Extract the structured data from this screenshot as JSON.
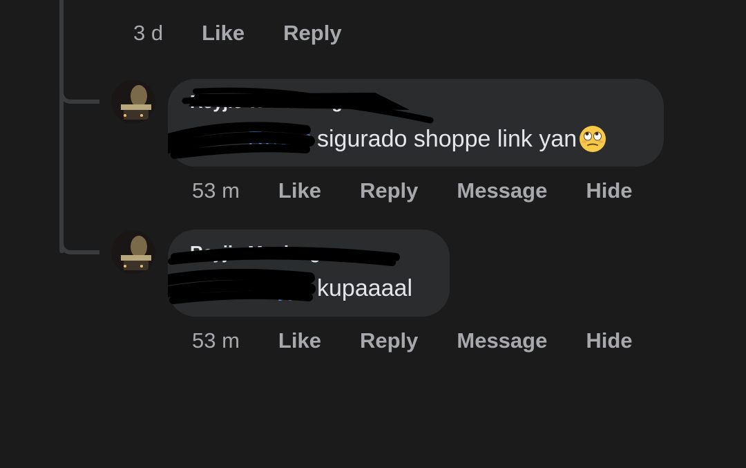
{
  "top_comment": {
    "time": "3 d",
    "like_label": "Like",
    "reply_label": "Reply"
  },
  "replies": [
    {
      "author": "Reyjie W Manlang",
      "mention": "Reyjie",
      "text": "sigurado shoppe link yan",
      "emoji": "face-with-rolling-eyes-emoji",
      "time": "53 m",
      "like_label": "Like",
      "reply_label": "Reply",
      "message_label": "Message",
      "hide_label": "Hide"
    },
    {
      "author": "Reyjie Manlang",
      "mention": "Reyjie",
      "text": "kupaaaal",
      "time": "53 m",
      "like_label": "Like",
      "reply_label": "Reply",
      "message_label": "Message",
      "hide_label": "Hide"
    }
  ],
  "colors": {
    "background": "#1b1b1c",
    "bubble": "#2b2c2e",
    "text": "#e4e6eb",
    "action_text": "#a8a9ad",
    "thread_line": "#3a3b3c",
    "mention": "#4d8bf0"
  }
}
